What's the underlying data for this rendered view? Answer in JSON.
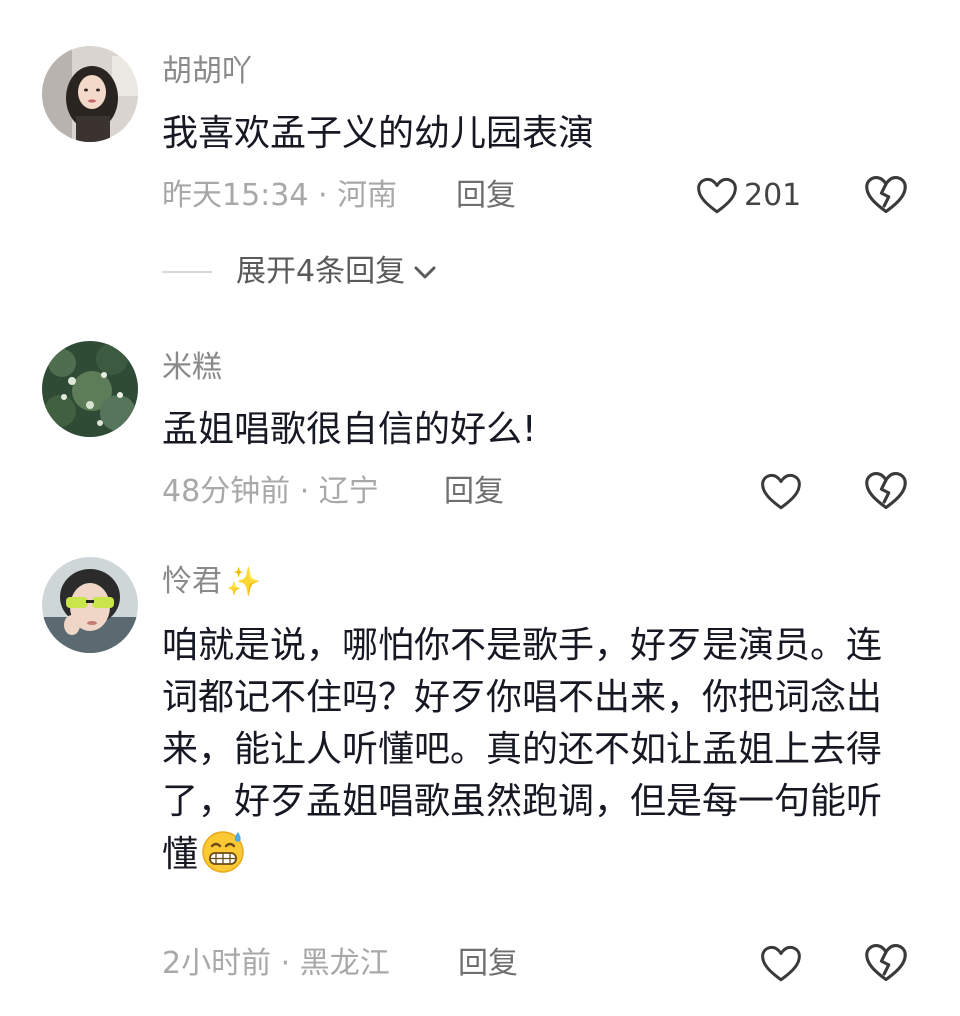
{
  "comments": [
    {
      "username": "胡胡吖",
      "text": "我喜欢孟子义的幼儿园表演",
      "meta": "昨天15:34 · 河南",
      "reply_label": "回复",
      "like_count": "201",
      "expand_label": "展开4条回复"
    },
    {
      "username": "米糕",
      "text": "孟姐唱歌很自信的好么!",
      "meta": "48分钟前 · 辽宁",
      "reply_label": "回复"
    },
    {
      "username": "怜君",
      "username_emoji": "✨",
      "text": "咱就是说，哪怕你不是歌手，好歹是演员。连词都记不住吗？好歹你唱不出来，你把词念出来，能让人听懂吧。真的还不如让孟姐上去得了，好歹孟姐唱歌虽然跑调，但是每一句能听懂",
      "text_emoji": "grinning-sweat-emoji",
      "meta": "2小时前 · 黑龙江",
      "reply_label": "回复"
    }
  ],
  "icons": {
    "like": "heart-outline-icon",
    "dislike": "broken-heart-icon",
    "expand": "chevron-down-icon"
  },
  "colors": {
    "text_primary": "#161823",
    "text_secondary": "#8a8a8a",
    "meta": "#a8a8a8",
    "icon": "#3a3a3a"
  }
}
